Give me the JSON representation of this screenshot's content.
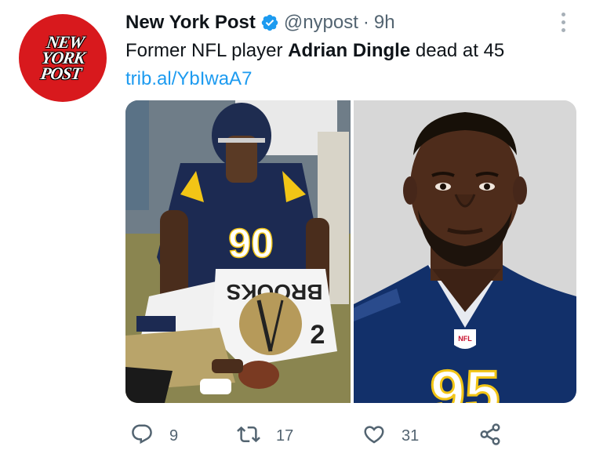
{
  "author": {
    "display_name": "New York Post",
    "handle": "@nypost",
    "separator": "·",
    "time": "9h",
    "avatar_lines": [
      "NEW",
      "YORK",
      "POST"
    ]
  },
  "tweet": {
    "text_before": "Former NFL player ",
    "text_bold": "Adrian Dingle",
    "text_after": " dead at 45",
    "link": "trib.al/YbIwaA7"
  },
  "media": {
    "left_jersey_front": "90",
    "left_jersey_back": "2",
    "left_jersey_name": "BROOKS",
    "right_jersey_number": "95",
    "right_badge": "NFL"
  },
  "actions": {
    "reply_count": "9",
    "retweet_count": "17",
    "like_count": "31"
  },
  "colors": {
    "accent": "#1d9bf0",
    "muted": "#536471",
    "brand_red": "#d8191d"
  }
}
